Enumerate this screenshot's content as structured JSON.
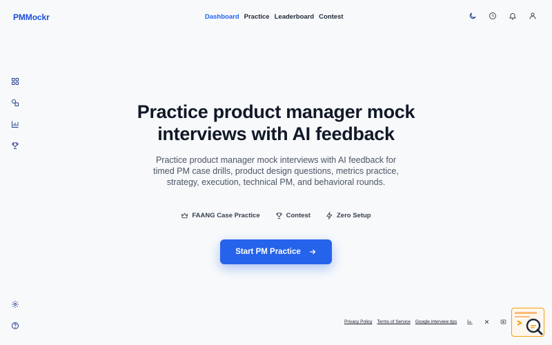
{
  "brand": "PMMockr",
  "nav": {
    "items": [
      "Dashboard",
      "Practice",
      "Leaderboard",
      "Contest"
    ],
    "active": "Dashboard"
  },
  "top_icons": [
    "moon-icon",
    "clock-icon",
    "bell-icon",
    "user-icon"
  ],
  "sidebar": {
    "icons": [
      "grid-icon",
      "shapes-icon",
      "bar-chart-icon",
      "trophy-icon"
    ],
    "bottom_icons": [
      "settings-icon",
      "help-icon"
    ]
  },
  "hero": {
    "title": "Practice product manager mock interviews with AI feedback",
    "description": "Practice product manager mock interviews with AI feedback for timed PM case drills, product design questions, metrics practice, strategy, execution, technical PM, and behavioral rounds."
  },
  "features": [
    {
      "icon": "crown-icon",
      "label": "FAANG Case Practice"
    },
    {
      "icon": "trophy-icon",
      "label": "Contest"
    },
    {
      "icon": "bolt-icon",
      "label": "Zero Setup"
    }
  ],
  "cta": {
    "label": "Start PM Practice",
    "icon": "arrow-right-icon"
  },
  "footer": {
    "links": [
      "Privacy Policy",
      "Terms of Service",
      "Google interview tips"
    ],
    "icons": [
      "bar-chart-icon",
      "close-icon",
      "play-icon"
    ]
  },
  "colors": {
    "accent": "#2563eb",
    "brand": "#1d4ed8",
    "background": "#f7f9fb",
    "widget_border": "#f59e0b"
  }
}
